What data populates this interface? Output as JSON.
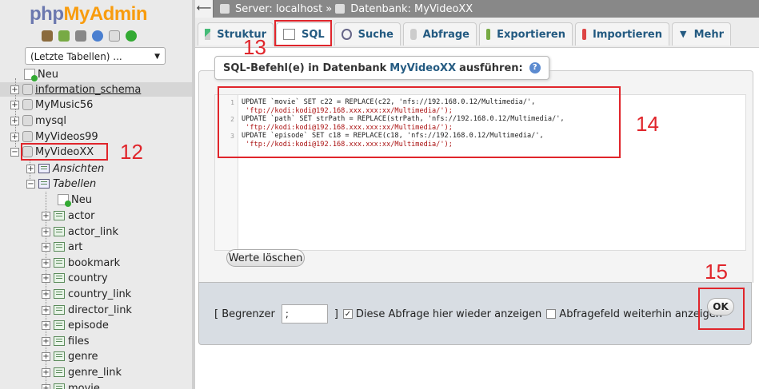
{
  "logo": {
    "part1": "php",
    "part2": "MyAdmin"
  },
  "recent_tables": "(Letzte Tabellen) ...",
  "tree": {
    "new": "Neu",
    "databases": [
      "information_schema",
      "MyMusic56",
      "mysql",
      "MyVideos99",
      "MyVideoXX"
    ],
    "views": "Ansichten",
    "tables_label": "Tabellen",
    "tables_new": "Neu",
    "tables": [
      "actor",
      "actor_link",
      "art",
      "bookmark",
      "country",
      "country_link",
      "director_link",
      "episode",
      "files",
      "genre",
      "genre_link",
      "movie"
    ]
  },
  "breadcrumb": {
    "server": "Server: localhost",
    "sep": "»",
    "database": "Datenbank: MyVideoXX"
  },
  "tabs": [
    "Struktur",
    "SQL",
    "Suche",
    "Abfrage",
    "Exportieren",
    "Importieren",
    "Mehr"
  ],
  "legend": {
    "prefix": "SQL-Befehl(e) in Datenbank",
    "db": "MyVideoXX",
    "suffix": "ausführen:"
  },
  "editor": {
    "line_numbers": [
      "1",
      "2",
      "3"
    ],
    "lines": [
      [
        "UPDATE `movie` SET c22 = REPLACE(c22, 'nfs://192.168.0.12/Multimedia/',",
        " 'ftp://kodi:kodi@192.168.xxx.xxx:xx/Multimedia/');"
      ],
      [
        "UPDATE `path` SET strPath = REPLACE(strPath, 'nfs://192.168.0.12/Multimedia/',",
        " 'ftp://kodi:kodi@192.168.xxx.xxx:xx/Multimedia/');"
      ],
      [
        "UPDATE `episode` SET c18 = REPLACE(c18, 'nfs://192.168.0.12/Multimedia/',",
        " 'ftp://kodi:kodi@192.168.xxx.xxx:xx/Multimedia/');"
      ]
    ]
  },
  "clear_button": "Werte löschen",
  "footer": {
    "delimiter_label": "[ Begrenzer",
    "delimiter_value": ";",
    "bracket_close": "]",
    "show_query_label": "Diese Abfrage hier wieder anzeigen",
    "keep_box_label": "Abfragefeld weiterhin anzeigen",
    "ok": "OK"
  },
  "annotations": [
    "12",
    "13",
    "14",
    "15"
  ],
  "colors": {
    "annotation": "#e0252b",
    "link": "#235a81"
  }
}
